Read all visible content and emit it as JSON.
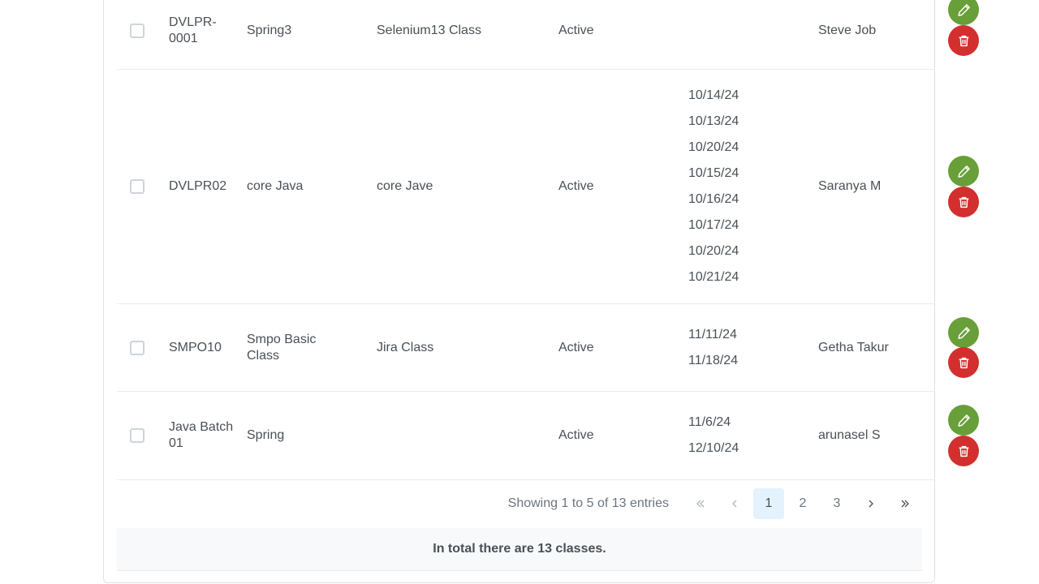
{
  "rows": [
    {
      "code": "DVLPR-0001",
      "batch": "Spring3",
      "topic": "Selenium13 Class",
      "status": "Active",
      "dates": [],
      "staff": "Steve Job"
    },
    {
      "code": "DVLPR02",
      "batch": "core Java",
      "topic": "core Jave",
      "status": "Active",
      "dates": [
        "10/14/24",
        "10/13/24",
        "10/20/24",
        "10/15/24",
        "10/16/24",
        "10/17/24",
        "10/20/24",
        "10/21/24"
      ],
      "staff": "Saranya M"
    },
    {
      "code": "SMPO10",
      "batch": "Smpo Basic Class",
      "topic": "Jira Class",
      "status": "Active",
      "dates": [
        "11/11/24",
        "11/18/24"
      ],
      "staff": "Getha Takur"
    },
    {
      "code": "Java Batch 01",
      "batch": "Spring",
      "topic": "",
      "status": "Active",
      "dates": [
        "11/6/24",
        "12/10/24"
      ],
      "staff": "arunasel S"
    }
  ],
  "pagination": {
    "info": "Showing 1 to 5 of 13 entries",
    "pages": [
      "1",
      "2",
      "3"
    ],
    "current": "1"
  },
  "footer": {
    "summary": "In total there are 13 classes."
  },
  "colors": {
    "edit_button": "#689f38",
    "delete_button": "#d32f2f",
    "active_page_bg": "#e3f2fd"
  },
  "icons": {
    "edit": "pencil-icon",
    "delete": "trash-icon",
    "first": "double-chevron-left-icon",
    "prev": "chevron-left-icon",
    "next": "chevron-right-icon",
    "last": "double-chevron-right-icon"
  }
}
